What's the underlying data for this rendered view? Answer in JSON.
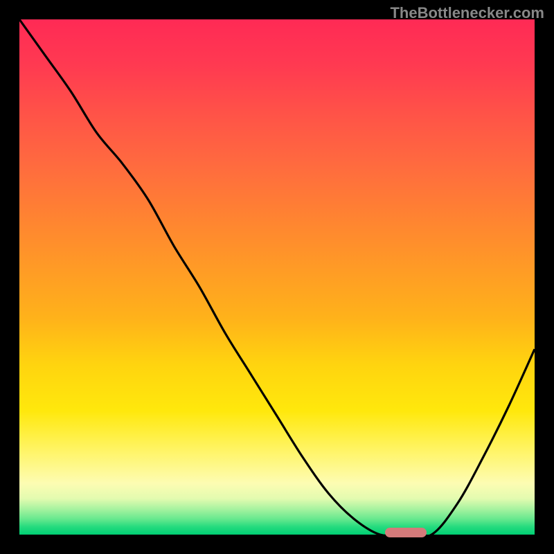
{
  "chart_data": {
    "type": "line",
    "title": "",
    "xlabel": "",
    "ylabel": "",
    "categories": [],
    "x": [
      0,
      0.05,
      0.1,
      0.15,
      0.2,
      0.25,
      0.3,
      0.35,
      0.4,
      0.45,
      0.5,
      0.55,
      0.6,
      0.65,
      0.7,
      0.75,
      0.8,
      0.85,
      0.9,
      0.95,
      1.0
    ],
    "series": [
      {
        "name": "curve",
        "color": "#000000",
        "values": [
          100,
          93,
          86,
          78,
          72,
          65,
          56,
          48,
          39,
          31,
          23,
          15,
          8,
          3,
          0,
          0,
          0,
          6,
          15,
          25,
          36
        ]
      }
    ],
    "xlim": [
      0,
      1
    ],
    "ylim": [
      0,
      100
    ],
    "marker": {
      "x_start": 0.71,
      "x_end": 0.79,
      "y": 0
    },
    "gradient_stops": [
      {
        "pos": 0.0,
        "color": "#ff2a55"
      },
      {
        "pos": 0.5,
        "color": "#ffb400"
      },
      {
        "pos": 0.9,
        "color": "#fff56a"
      },
      {
        "pos": 1.0,
        "color": "#00d074"
      }
    ]
  },
  "watermark": "TheBottlenecker.com"
}
